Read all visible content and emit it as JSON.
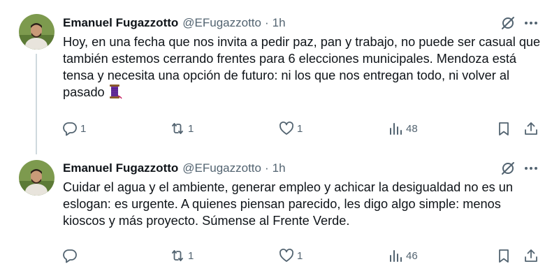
{
  "tweets": [
    {
      "author": "Emanuel Fugazzotto",
      "handle": "@EFugazzotto",
      "separator": "·",
      "time": "1h",
      "text": "Hoy, en una fecha que nos invita a pedir paz, pan y trabajo, no puede ser casual que también estemos cerrando frentes para 6 elecciones municipales. Mendoza está tensa y necesita una opción de futuro: ni los que nos entregan todo, ni volver al pasado",
      "emoji": "thread-spool-emoji",
      "replies": "1",
      "retweets": "1",
      "likes": "1",
      "views": "48"
    },
    {
      "author": "Emanuel Fugazzotto",
      "handle": "@EFugazzotto",
      "separator": "·",
      "time": "1h",
      "text": "Cuidar el agua y el ambiente, generar empleo y achicar la desigualdad no es un eslogan: es urgente. A quienes piensan parecido, les digo algo simple: menos kioscos y más proyecto. Súmense al Frente Verde.",
      "replies": "",
      "retweets": "1",
      "likes": "1",
      "views": "46"
    }
  ],
  "colors": {
    "text": "#0f1419",
    "secondary": "#536471",
    "thread_line": "#cfd9de"
  },
  "icons": [
    "reply-icon",
    "retweet-icon",
    "like-icon",
    "views-icon",
    "bookmark-icon",
    "share-icon",
    "grok-icon",
    "more-icon"
  ]
}
